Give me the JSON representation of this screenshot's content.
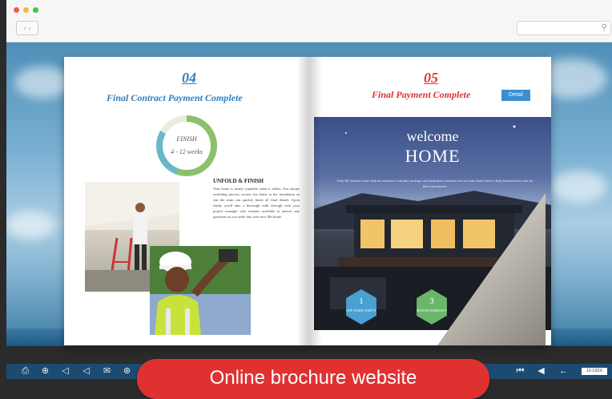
{
  "colors": {
    "accent_blue": "#2f7fbf",
    "accent_red": "#e03131",
    "toolbar": "#1d4a70",
    "traffic_red": "#f25a4f",
    "traffic_yellow": "#f6b83f",
    "traffic_green": "#3fc64a",
    "ring_green": "#8cc06a",
    "ring_blue": "#6ab7c8",
    "hex_blue": "#4aa0d0",
    "hex_green": "#6ab76a"
  },
  "browser": {
    "nav_icon": "back-forward-icon",
    "search_icon": "search-icon",
    "search_glyph": "⚲"
  },
  "left_page": {
    "number": "04",
    "title": "Final Contract Payment Complete",
    "progress_line1": "FINISH",
    "progress_line2": "4 - 12 weeks",
    "progress_fraction": 0.83,
    "section_title": "UNFOLD & FINISH",
    "section_text": "Your home is nearly complete when it settles. Our unique unfolding process secures the home to the foundation so can the team can quickly finish all final details. Upon finish, you'll take a thorough walk through with your project manager who remains available to answer any questions as you settle into your new Mo home."
  },
  "right_page": {
    "number": "05",
    "title": "Final Payment Complete",
    "detail_button": "Detail",
    "welcome": "welcome",
    "home": "HOME",
    "tagline": "Only Mo houses come with an extensive warranty package and dedicated customer service team that's here to help homeowners care for their investment.",
    "hex1_number": "1",
    "hex1_text": "SITE WORK SAFETY",
    "hex2_number": "3",
    "hex2_text": "MONTH WARRANTY"
  },
  "toolbar": {
    "icons": [
      "print-icon",
      "zoom-icon",
      "sound-icon",
      "share-icon",
      "email-icon",
      "thumbnails-icon"
    ],
    "glyphs": [
      "⎙",
      "⊕",
      "◁",
      "◁",
      "✉",
      "⊛"
    ],
    "nav_icons": [
      "first-page-icon",
      "previous-page-icon",
      "next-page-icon"
    ],
    "nav_glyphs": [
      "⏮",
      "◀",
      "←"
    ],
    "page_indicator": "12-13/16"
  },
  "banner": {
    "text": "Online brochure website"
  }
}
